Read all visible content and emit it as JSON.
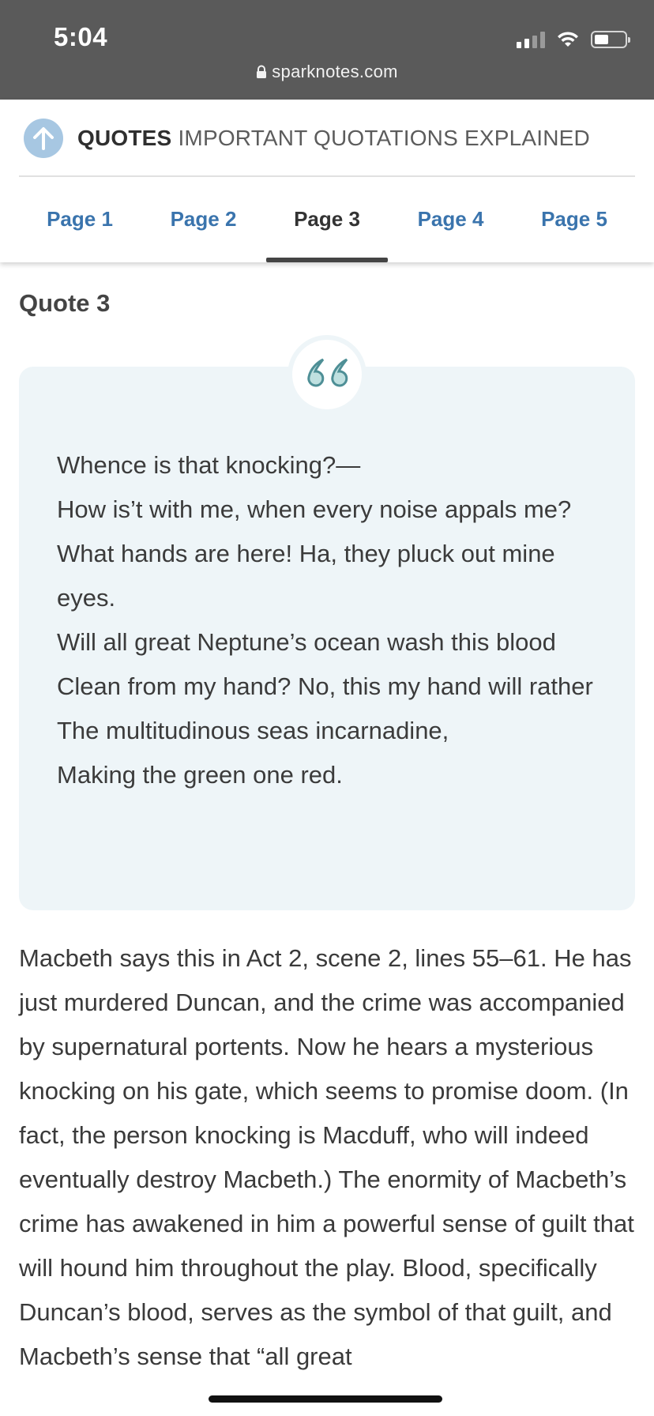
{
  "status_bar": {
    "time": "5:04",
    "url": "sparknotes.com"
  },
  "header": {
    "section_title": "QUOTES",
    "section_subtitle": "IMPORTANT QUOTATIONS EXPLAINED",
    "tabs": [
      {
        "label": "Page 1",
        "active": false
      },
      {
        "label": "Page 2",
        "active": false
      },
      {
        "label": "Page 3",
        "active": true
      },
      {
        "label": "Page 4",
        "active": false
      },
      {
        "label": "Page 5",
        "active": false
      }
    ]
  },
  "content": {
    "quote_heading": "Quote 3",
    "quote_lines": [
      "Whence is that knocking?—",
      "How is’t with me, when every noise appals me?",
      "What hands are here! Ha, they pluck out mine eyes.",
      "Will all great Neptune’s ocean wash this blood",
      "Clean from my hand? No, this my hand will rather",
      "The multitudinous seas incarnadine,",
      "Making the green one red."
    ],
    "explanation": "Macbeth says this in Act 2, scene 2, lines 55–61. He has just murdered Duncan, and the crime was accompanied by supernatural portents. Now he hears a mysterious knocking on his gate, which seems to promise doom. (In fact, the person knocking is Macduff, who will indeed eventually destroy Macbeth.) The enormity of Macbeth’s crime has awakened in him a powerful sense of guilt that will hound him throughout the play. Blood, specifically Duncan’s blood, serves as the symbol of that guilt, and Macbeth’s sense that “all great"
  },
  "icons": {
    "lock": "lock-icon",
    "back_to_top": "arrow-up-icon",
    "quote": "quote-mark-icon",
    "signal": "cellular-signal-icon",
    "wifi": "wifi-icon",
    "battery": "battery-icon"
  },
  "colors": {
    "status_bar_bg": "#5a5a5a",
    "tab_link": "#3a74ad",
    "quote_box_bg": "#eef5f8",
    "quote_mark": "#4e8f96",
    "up_circle": "#a7c7e2"
  }
}
